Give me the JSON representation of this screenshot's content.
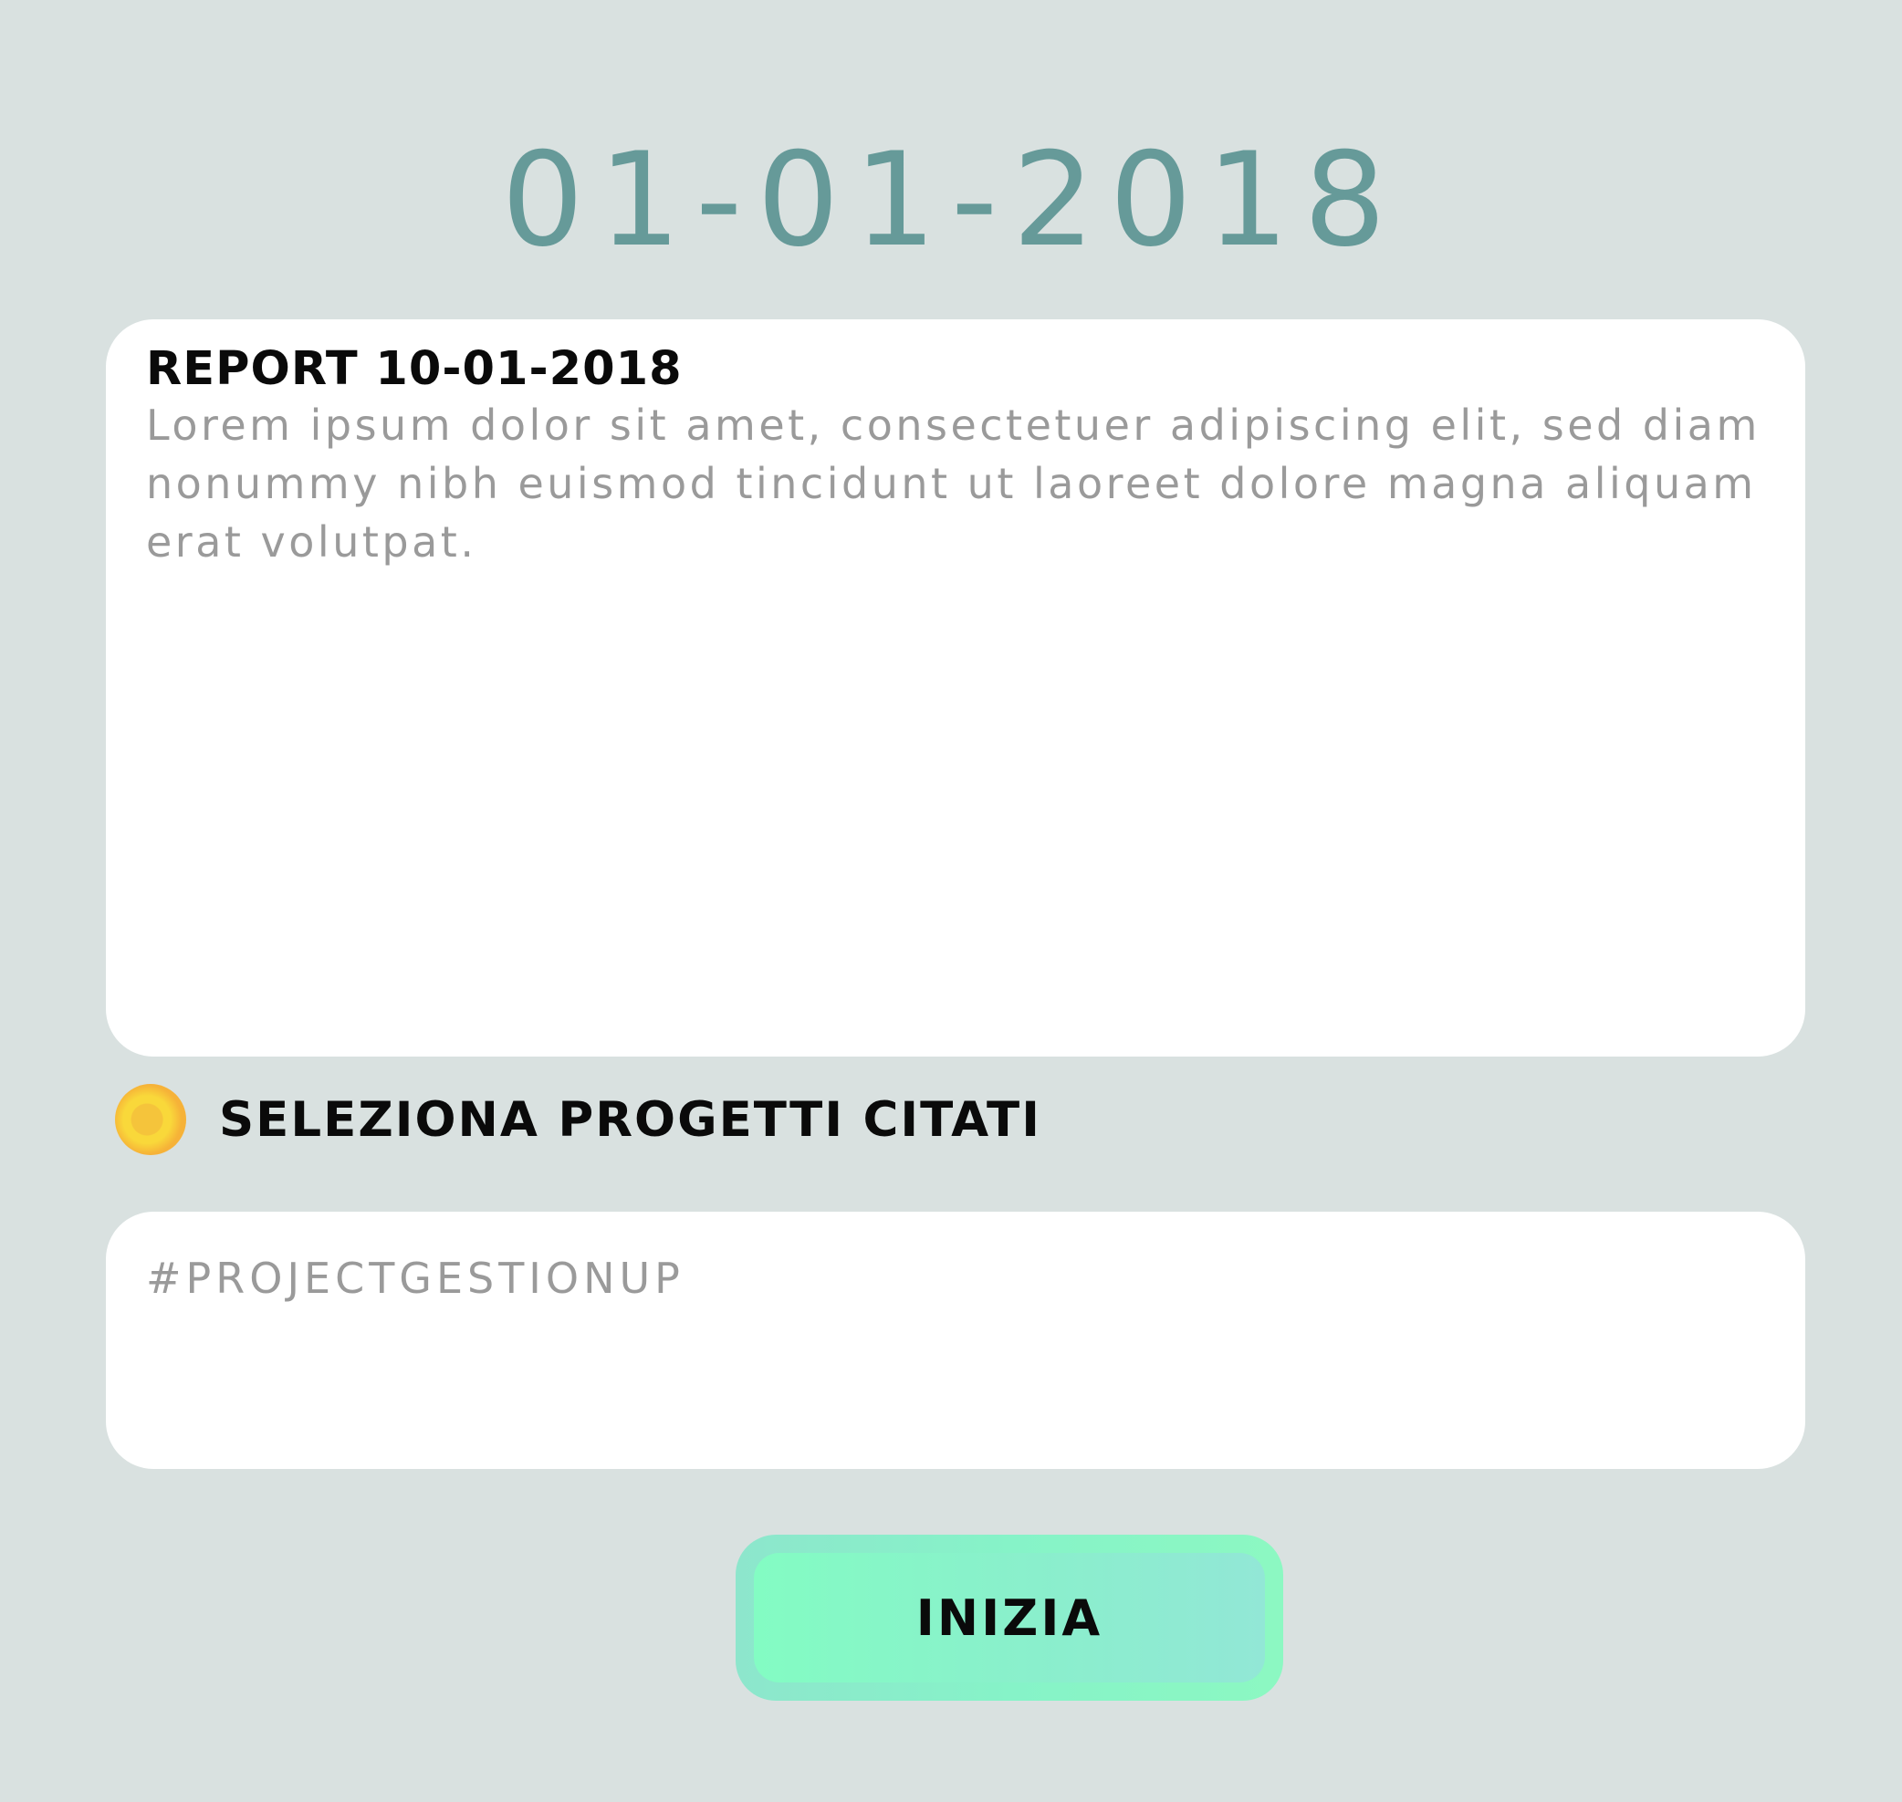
{
  "header": {
    "date": "01-01-2018"
  },
  "report": {
    "title": "REPORT 10-01-2018",
    "body": "Lorem ipsum dolor sit amet, consectetuer adipiscing elit, sed diam nonummy nibh euismod tincidunt ut laoreet dolore magna aliquam erat volutpat."
  },
  "projects": {
    "select_label": "SELEZIONA PROGETTI CITATI",
    "radio_icon": "radio-dot-icon"
  },
  "hashtag": {
    "value": "",
    "placeholder": "#PROJECTGESTIONUP"
  },
  "actions": {
    "start_label": "INIZIA"
  },
  "colors": {
    "background": "#d9e1e0",
    "date_text": "#669a99",
    "card": "#ffffff",
    "placeholder_text": "#9a9a9a",
    "accent_button": "#86f3c8",
    "radio_dot": "#f6b238"
  }
}
